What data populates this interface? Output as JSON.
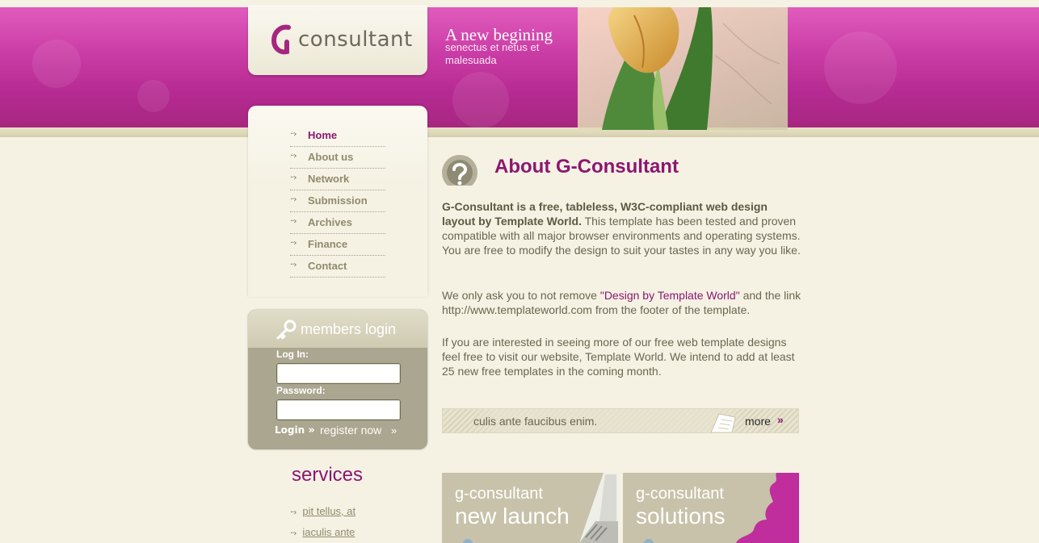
{
  "header": {
    "logo_text": "consultant",
    "tagline_title": "A new begining",
    "tagline_sub": "senectus et netus et malesuada"
  },
  "nav": {
    "items": [
      {
        "label": "Home",
        "active": true
      },
      {
        "label": "About us",
        "active": false
      },
      {
        "label": "Network",
        "active": false
      },
      {
        "label": "Submission",
        "active": false
      },
      {
        "label": "Archives",
        "active": false
      },
      {
        "label": "Finance",
        "active": false
      },
      {
        "label": "Contact",
        "active": false
      }
    ]
  },
  "login": {
    "title": "members login",
    "login_label": "Log In:",
    "login_value": "",
    "password_label": "Password:",
    "password_value": "",
    "submit_label": "Login",
    "register_label": "register now"
  },
  "services": {
    "title": "services",
    "items": [
      "pit tellus, at",
      "iaculis ante"
    ]
  },
  "about": {
    "title": "About G-Consultant",
    "p1_bold": "G-Consultant is a free, tableless, W3C-compliant web design layout by Template World.",
    "p1_rest": " This template has been tested and proven compatible with all major browser environments and operating systems. You are free to modify the design to suit your tastes in any way you like.",
    "p2_a": "We only ask you to not remove ",
    "p2_link": "\"Design by Template World\"",
    "p2_b": " and the link http://www.templateworld.com from the footer of the template.",
    "p3": "If you are interested in seeing more of our free web template designs feel free to visit our website, Template World. We intend to add at least 25 new free templates in the coming month."
  },
  "strip": {
    "text": "culis ante faucibus enim.",
    "more_label": "more"
  },
  "promos": [
    {
      "small": "g-consultant",
      "big": "new launch"
    },
    {
      "small": "g-consultant",
      "big": "solutions"
    }
  ],
  "colors": {
    "accent": "#8c1670",
    "banner": "#cc3ea7",
    "background": "#f5f2e4"
  }
}
